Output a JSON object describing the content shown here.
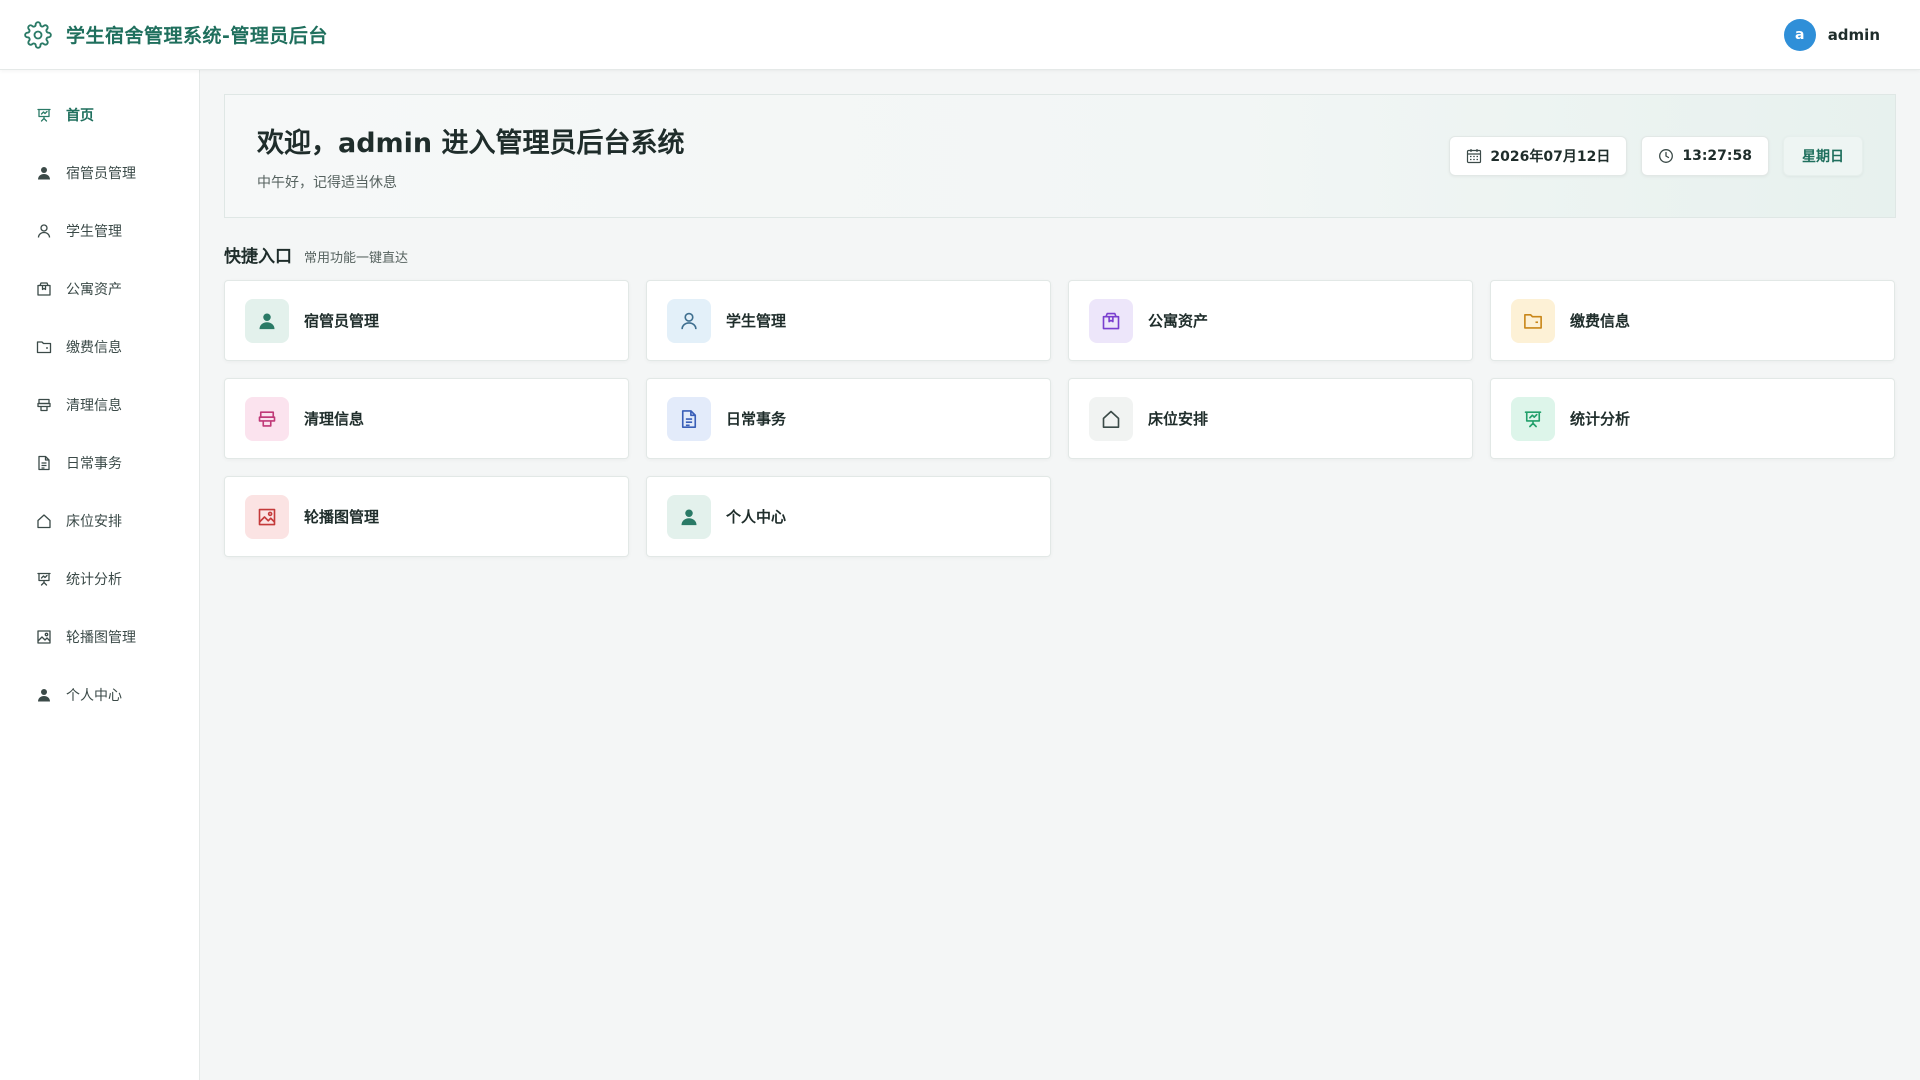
{
  "header": {
    "title": "学生宿舍管理系统-管理员后台",
    "logo_icon": "gear-icon",
    "user": {
      "avatar_letter": "a",
      "name": "admin",
      "avatar_color": "#2f8fd8"
    }
  },
  "sidebar": {
    "items": [
      {
        "label": "首页",
        "icon": "presentation-board-icon",
        "active": true
      },
      {
        "label": "宿管员管理",
        "icon": "user-filled-icon"
      },
      {
        "label": "学生管理",
        "icon": "user-outline-icon"
      },
      {
        "label": "公寓资产",
        "icon": "box-icon"
      },
      {
        "label": "缴费信息",
        "icon": "folder-icon"
      },
      {
        "label": "清理信息",
        "icon": "cleaning-tool-icon"
      },
      {
        "label": "日常事务",
        "icon": "document-icon"
      },
      {
        "label": "床位安排",
        "icon": "house-icon"
      },
      {
        "label": "统计分析",
        "icon": "presentation-board-icon"
      },
      {
        "label": "轮播图管理",
        "icon": "image-icon"
      },
      {
        "label": "个人中心",
        "icon": "user-filled-icon"
      }
    ]
  },
  "welcome": {
    "title": "欢迎，admin 进入管理员后台系统",
    "subtitle": "中午好，记得适当休息",
    "date": "2026年07月12日",
    "time": "13:27:58",
    "weekday": "星期日"
  },
  "quick": {
    "title": "快捷入口",
    "subtitle": "常用功能一键直达",
    "items": [
      {
        "label": "宿管员管理",
        "icon": "user-filled-icon",
        "bg": "#e3f1ec",
        "fg": "#2a7a66"
      },
      {
        "label": "学生管理",
        "icon": "user-outline-icon",
        "bg": "#e3f0f9",
        "fg": "#3f6f8f"
      },
      {
        "label": "公寓资产",
        "icon": "box-icon",
        "bg": "#ede6fa",
        "fg": "#7a3fcf"
      },
      {
        "label": "缴费信息",
        "icon": "folder-icon",
        "bg": "#fdf1d6",
        "fg": "#c9871a"
      },
      {
        "label": "清理信息",
        "icon": "cleaning-tool-icon",
        "bg": "#fbe3ee",
        "fg": "#c03a78"
      },
      {
        "label": "日常事务",
        "icon": "document-icon",
        "bg": "#e3ebfa",
        "fg": "#3a5fb8"
      },
      {
        "label": "床位安排",
        "icon": "house-icon",
        "bg": "#f1f3f2",
        "fg": "#3b4a48"
      },
      {
        "label": "统计分析",
        "icon": "presentation-board-icon",
        "bg": "#ddf5ea",
        "fg": "#22a06b"
      },
      {
        "label": "轮播图管理",
        "icon": "image-icon",
        "bg": "#fbe3e3",
        "fg": "#c43a3a"
      },
      {
        "label": "个人中心",
        "icon": "user-filled-icon",
        "bg": "#e3f1ec",
        "fg": "#2a7a66"
      }
    ]
  }
}
